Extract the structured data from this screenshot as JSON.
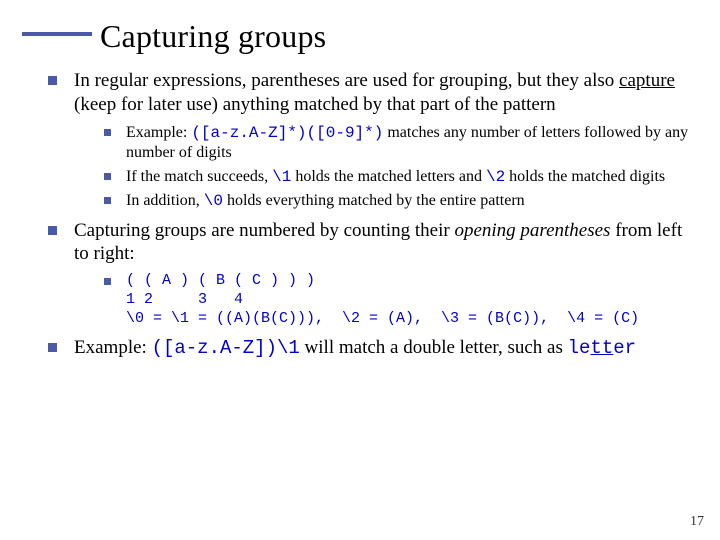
{
  "title": "Capturing groups",
  "bullets": {
    "b1_pre": "In regular expressions, parentheses are used for grouping, but they also ",
    "b1_u": "capture",
    "b1_post": " (keep for later use) anything matched by that part of the pattern",
    "b1_sub": {
      "s1_pre": "Example: ",
      "s1_code": "([a-z.A-Z]*)([0-9]*)",
      "s1_post": " matches any number of letters followed by any number of digits",
      "s2_pre": "If the match succeeds, ",
      "s2_c1": "\\1",
      "s2_mid": " holds the matched letters and ",
      "s2_c2": "\\2",
      "s2_post": " holds the matched digits",
      "s3_pre": "In addition, ",
      "s3_c": "\\0",
      "s3_post": " holds everything matched by the entire pattern"
    },
    "b2_pre": "Capturing groups are numbered by counting their ",
    "b2_i": "opening parentheses",
    "b2_post": " from left to right:",
    "b2_code": "( ( A ) ( B ( C ) ) )\n1 2     3   4\n\\0 = \\1 = ((A)(B(C))),  \\2 = (A),  \\3 = (B(C)),  \\4 = (C)",
    "b3_pre": "Example: ",
    "b3_code": "([a-z.A-Z])\\1",
    "b3_mid": " will match a double letter, such as ",
    "b3_word_a": "le",
    "b3_word_b": "tt",
    "b3_word_c": "er"
  },
  "page_number": "17"
}
